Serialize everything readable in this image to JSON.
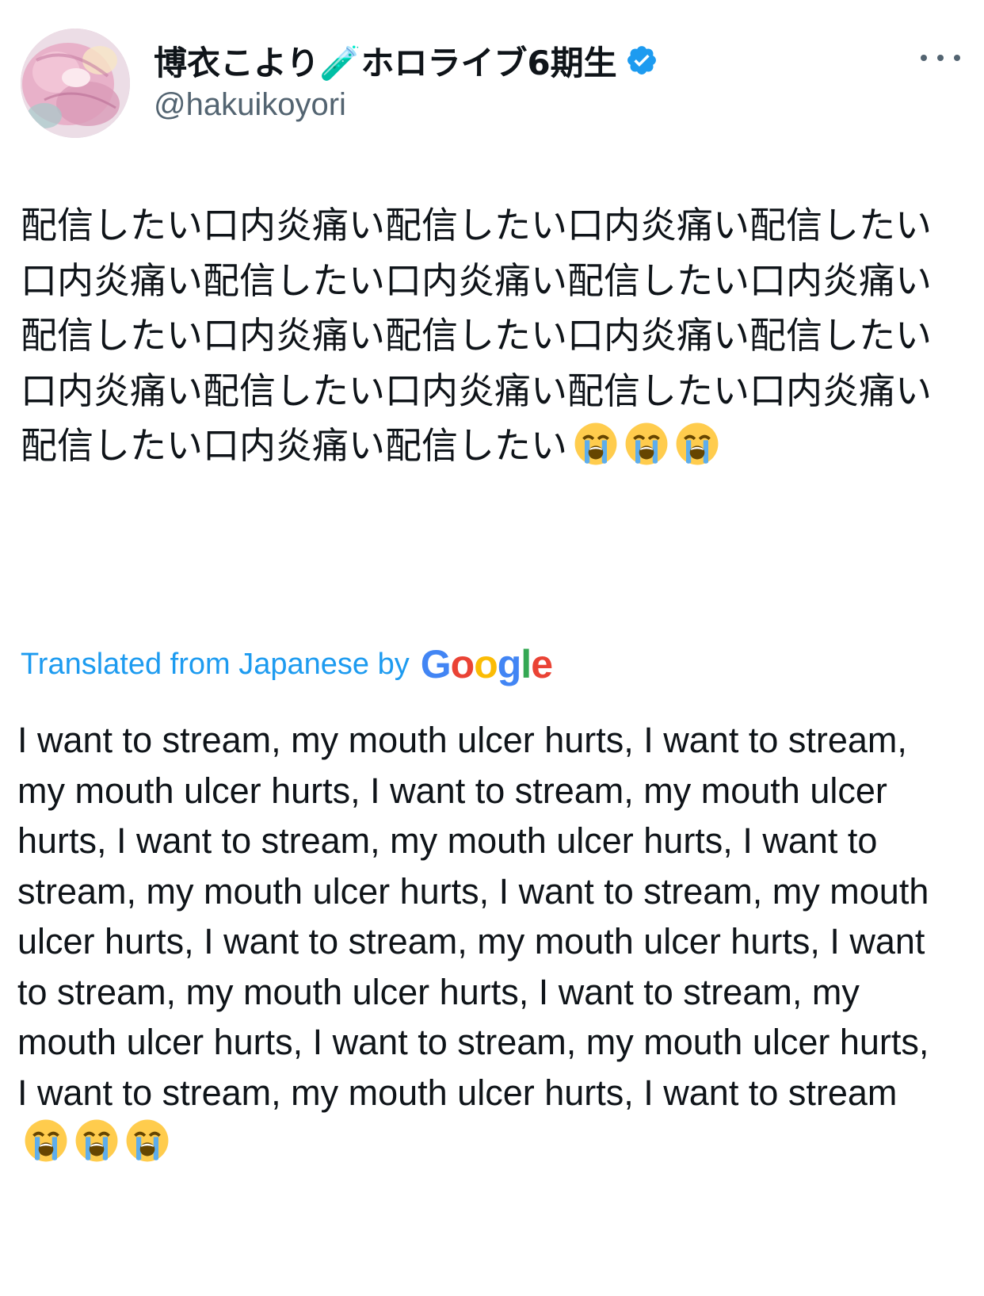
{
  "author": {
    "display_name": "博衣こより🧪ホロライブ6期生",
    "handle": "@hakuikoyori",
    "verified": true,
    "avatar_icon": "avatar-image",
    "verified_icon": "verified-badge-icon"
  },
  "menu": {
    "icon": "more-options-icon"
  },
  "tweet": {
    "original_text": "配信したい口内炎痛い配信したい口内炎痛い配信したい口内炎痛い配信したい口内炎痛い配信したい口内炎痛い配信したい口内炎痛い配信したい口内炎痛い配信したい口内炎痛い配信したい口内炎痛い配信したい口内炎痛い配信したい口内炎痛い配信したい",
    "original_emojis": [
      "loudly-crying-face",
      "loudly-crying-face",
      "loudly-crying-face"
    ],
    "translation_label": "Translated from Japanese by",
    "translation_provider": "Google",
    "translated_text": "I want to stream, my mouth ulcer hurts, I want to stream, my mouth ulcer hurts, I want to stream, my mouth ulcer hurts, I want to stream, my mouth ulcer hurts, I want to stream, my mouth ulcer hurts, I want to stream, my mouth ulcer hurts, I want to stream, my mouth ulcer hurts, I want to stream, my mouth ulcer hurts, I want to stream, my mouth ulcer hurts, I want to stream, my mouth ulcer hurts, I want to stream, my mouth ulcer hurts, I want to stream",
    "translated_emojis": [
      "loudly-crying-face",
      "loudly-crying-face",
      "loudly-crying-face"
    ]
  },
  "colors": {
    "text": "#0f1419",
    "secondary": "#536471",
    "link": "#1d9bf0",
    "verified": "#1d9bf0",
    "google_blue": "#4285F4",
    "google_red": "#EA4335",
    "google_yellow": "#FBBC05",
    "google_green": "#34A853"
  }
}
